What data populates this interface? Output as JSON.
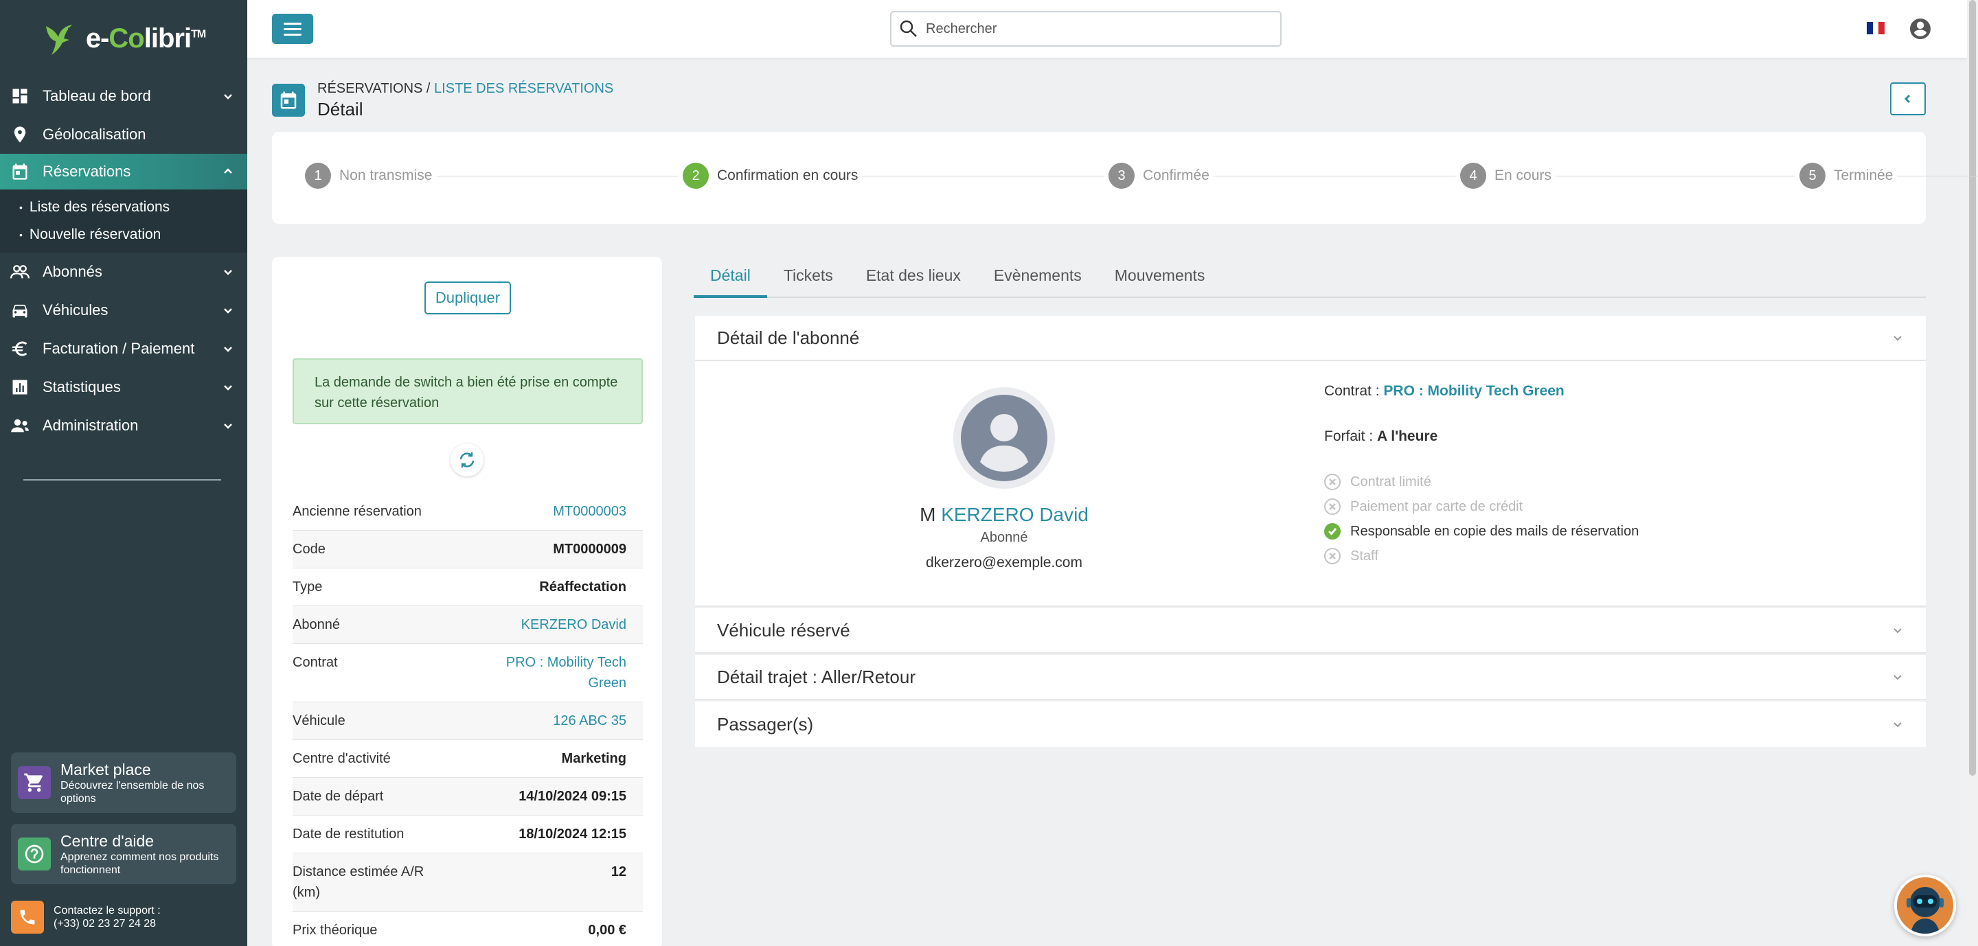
{
  "app": {
    "logo_text_a": "e-",
    "logo_text_b": "Co",
    "logo_text_c": "libri",
    "logo_tm": "TM"
  },
  "sidebar": {
    "items": [
      {
        "label": "Tableau de bord",
        "icon": "dashboard-icon",
        "has_chevron": true
      },
      {
        "label": "Géolocalisation",
        "icon": "map-pin-icon",
        "has_chevron": false
      },
      {
        "label": "Réservations",
        "icon": "calendar-icon",
        "has_chevron": true,
        "active": true
      },
      {
        "label": "Abonnés",
        "icon": "people-icon",
        "has_chevron": true
      },
      {
        "label": "Véhicules",
        "icon": "car-icon",
        "has_chevron": true
      },
      {
        "label": "Facturation / Paiement",
        "icon": "euro-icon",
        "has_chevron": true
      },
      {
        "label": "Statistiques",
        "icon": "chart-icon",
        "has_chevron": true
      },
      {
        "label": "Administration",
        "icon": "admin-icon",
        "has_chevron": true
      }
    ],
    "sub_items": [
      "Liste des réservations",
      "Nouvelle réservation"
    ],
    "market": {
      "title": "Market place",
      "desc": "Découvrez l'ensemble de nos options"
    },
    "help": {
      "title": "Centre d'aide",
      "desc": "Apprenez comment nos produits fonctionnent"
    },
    "support": {
      "line1": "Contactez le support :",
      "line2": "(+33) 02 23 27 24 28"
    }
  },
  "topbar": {
    "search_placeholder": "Rechercher",
    "language": "FR"
  },
  "breadcrumb": {
    "root": "RÉSERVATIONS",
    "sep": " / ",
    "current": "LISTE DES RÉSERVATIONS",
    "title": "Détail"
  },
  "stepper": {
    "steps": [
      {
        "num": "1",
        "label": "Non transmise"
      },
      {
        "num": "2",
        "label": "Confirmation en cours",
        "current": true
      },
      {
        "num": "3",
        "label": "Confirmée"
      },
      {
        "num": "4",
        "label": "En cours"
      },
      {
        "num": "5",
        "label": "Terminée"
      }
    ]
  },
  "left": {
    "duplicate_label": "Dupliquer",
    "alert": "La demande de switch a bien été prise en compte sur cette réservation",
    "rows": [
      {
        "k": "Ancienne réservation",
        "v": "MT0000003",
        "link": true
      },
      {
        "k": "Code",
        "v": "MT0000009"
      },
      {
        "k": "Type",
        "v": "Réaffectation"
      },
      {
        "k": "Abonné",
        "v": "KERZERO David",
        "link": true
      },
      {
        "k": "Contrat",
        "v": "PRO : Mobility Tech Green",
        "link": true
      },
      {
        "k": "Véhicule",
        "v": "126 ABC 35",
        "link": true
      },
      {
        "k": "Centre d'activité",
        "v": "Marketing"
      },
      {
        "k": "Date de départ",
        "v": "14/10/2024 09:15"
      },
      {
        "k": "Date de restitution",
        "v": "18/10/2024 12:15"
      },
      {
        "k": "Distance estimée A/R (km)",
        "v": "12"
      },
      {
        "k": "Prix théorique",
        "v": "0,00 €"
      }
    ]
  },
  "tabs": [
    "Détail",
    "Tickets",
    "Etat des lieux",
    "Evènements",
    "Mouvements"
  ],
  "subscriber": {
    "section_title": "Détail de l'abonné",
    "civility": "M",
    "name": "KERZERO David",
    "role": "Abonné",
    "email": "dkerzero@exemple.com",
    "contract_label": "Contrat :",
    "contract_value": "PRO : Mobility Tech Green",
    "plan_label": "Forfait :",
    "plan_value": "A l'heure",
    "options": [
      {
        "label": "Contrat limité",
        "on": false
      },
      {
        "label": "Paiement par carte de crédit",
        "on": false
      },
      {
        "label": "Responsable en copie des mails de réservation",
        "on": true
      },
      {
        "label": "Staff",
        "on": false
      }
    ]
  },
  "sections": [
    "Véhicule réservé",
    "Détail trajet : Aller/Retour",
    "Passager(s)"
  ],
  "colors": {
    "accent": "#2a8ea6",
    "sidebar": "#2c3e44",
    "success": "#6cb33f",
    "market": "#6c4fa0",
    "help": "#4aa96c",
    "support": "#f08c3a"
  }
}
